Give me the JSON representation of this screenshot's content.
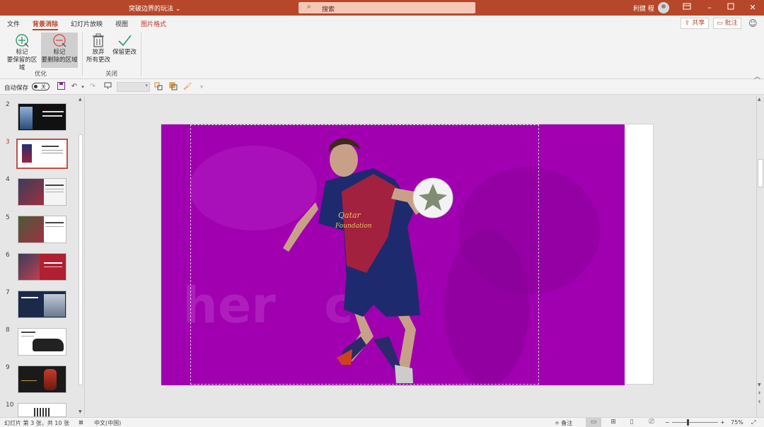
{
  "titlebar": {
    "doc_title": "突破边界的玩法",
    "doc_caret": "⌄",
    "search_placeholder": "搜索",
    "user_name": "利健 程",
    "controls": [
      "ribbon-display",
      "minimize",
      "maximize",
      "close"
    ]
  },
  "tabs": {
    "items": [
      "文件",
      "背景消除",
      "幻灯片放映",
      "视图",
      "图片格式"
    ],
    "active": "背景消除",
    "share_label": "共享",
    "comment_label": "批注"
  },
  "ribbon": {
    "mark_keep": {
      "line1": "标记",
      "line2": "要保留的区域"
    },
    "mark_remove": {
      "line1": "标记",
      "line2": "要删除的区域"
    },
    "discard": {
      "line1": "放弃",
      "line2": "所有更改"
    },
    "keep_changes": {
      "line1": "保留更改"
    },
    "group_optimize": "优化",
    "group_close": "关闭"
  },
  "qat": {
    "autosave_label": "自动保存",
    "autosave_state": "关"
  },
  "thumbnails": {
    "numbers": [
      "2",
      "3",
      "4",
      "5",
      "6",
      "7",
      "8",
      "9",
      "10"
    ],
    "current": "3"
  },
  "status": {
    "slide_info": "幻灯片 第 3 张，共 10 张",
    "language": "中文(中国)",
    "notes_label": "备注",
    "zoom": "75%"
  },
  "colors": {
    "accent": "#b7472a",
    "removal_overlay": "#a000b0",
    "jersey_blue": "#1e2a6e",
    "jersey_red": "#b0203a"
  }
}
